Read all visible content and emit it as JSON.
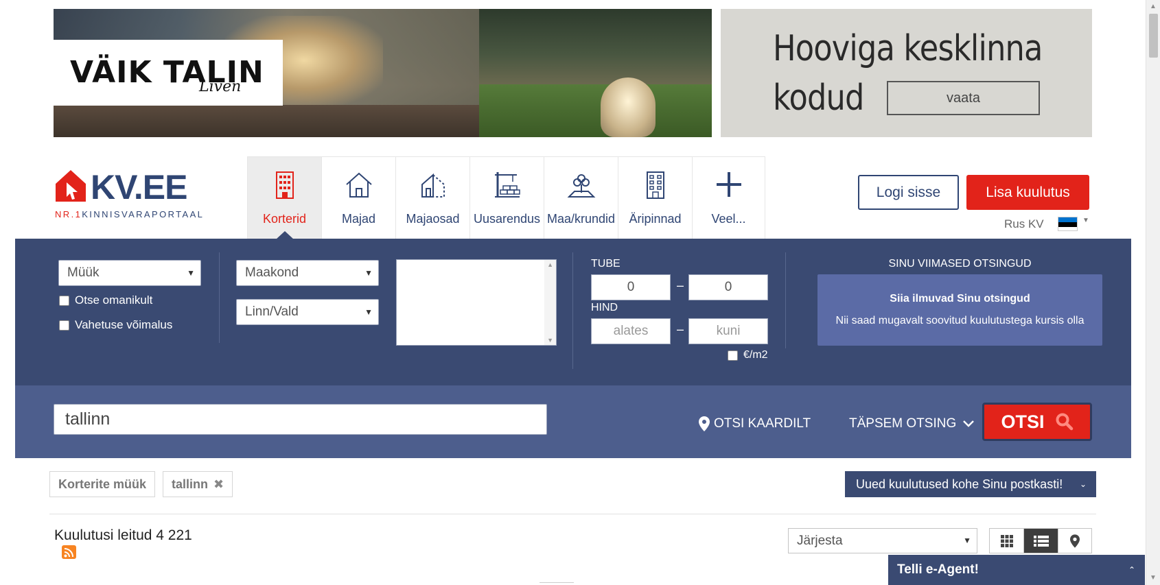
{
  "banners": {
    "left": {
      "logo_text_line1": "VÄIK TALIN",
      "logo_script": "Liven"
    },
    "right": {
      "headline_line1": "Hooviga kesklinna",
      "headline_line2": "kodud",
      "cta_label": "vaata"
    }
  },
  "header": {
    "brand": "KV.EE",
    "tagline_nr": "NR.1",
    "tagline_rest": "KINNISVARAPORTAAL",
    "nav": [
      {
        "label": "Korterid",
        "icon": "apartment-building-icon",
        "active": true
      },
      {
        "label": "Majad",
        "icon": "house-icon",
        "active": false
      },
      {
        "label": "Majaosad",
        "icon": "house-part-icon",
        "active": false
      },
      {
        "label": "Uusarendus",
        "icon": "crane-construction-icon",
        "active": false
      },
      {
        "label": "Maa/krundid",
        "icon": "land-tree-icon",
        "active": false
      },
      {
        "label": "Äripinnad",
        "icon": "office-building-icon",
        "active": false
      },
      {
        "label": "Veel...",
        "icon": "plus-icon",
        "active": false
      }
    ],
    "login_label": "Logi sisse",
    "add_listing_label": "Lisa kuulutus",
    "lang_link": "Rus KV"
  },
  "search_panel": {
    "deal_type": "Müük",
    "owner_only_label": "Otse omanikult",
    "exchange_label": "Vahetuse võimalus",
    "county_select": "Maakond",
    "city_select": "Linn/Vald",
    "rooms_label": "TUBE",
    "rooms_min": "0",
    "rooms_max": "0",
    "dash": "–",
    "price_label": "HIND",
    "price_min_placeholder": "alates",
    "price_max_placeholder": "kuni",
    "per_m2_label": "€/m2",
    "recent_title": "SINU VIIMASED OTSINGUD",
    "recent_heading": "Siia ilmuvad Sinu otsingud",
    "recent_text": "Nii saad mugavalt soovitud kuulutustega kursis olla"
  },
  "search_bar": {
    "keyword_value": "tallinn",
    "map_search_label": "OTSI KAARDILT",
    "advanced_label": "TÄPSEM OTSING",
    "search_button_label": "OTSI"
  },
  "filters": {
    "chips": [
      "Korterite müük",
      "tallinn"
    ],
    "email_alert_label": "Uued kuulutused kohe Sinu postkasti!"
  },
  "results": {
    "count_text": "Kuulutusi leitud 4 221",
    "sort_label": "Järjesta"
  },
  "eagent_label": "Telli e-Agent!",
  "colors": {
    "brand_blue": "#2f4573",
    "brand_red": "#e2231a",
    "panel_blue": "#3a4a72"
  }
}
